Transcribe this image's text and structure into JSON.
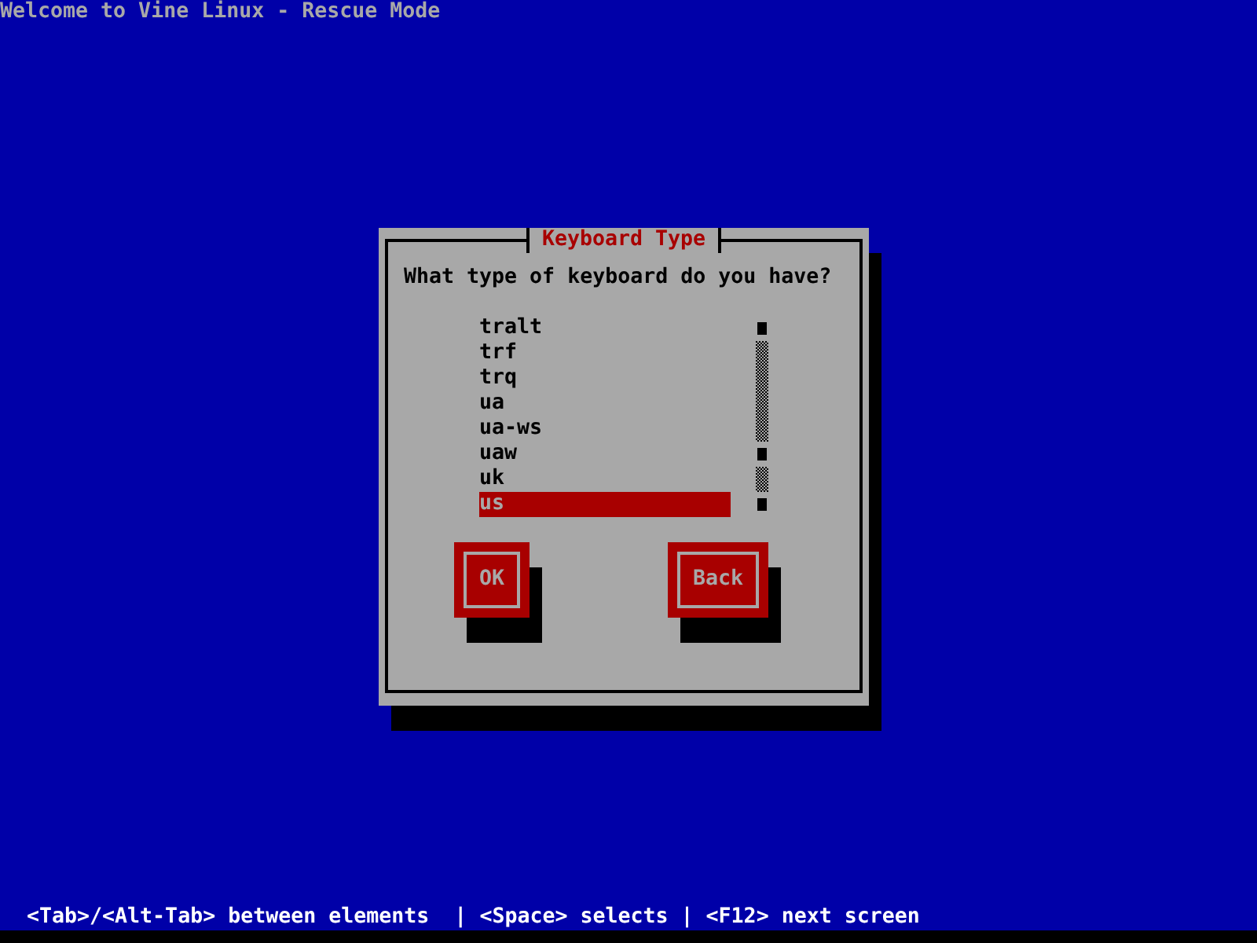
{
  "screen": {
    "title": "Welcome to Vine Linux - Rescue Mode"
  },
  "dialog": {
    "title": "Keyboard Type",
    "prompt": "What type of keyboard do you have?",
    "items": [
      {
        "label": "tralt",
        "selected": false
      },
      {
        "label": "trf",
        "selected": false
      },
      {
        "label": "trq",
        "selected": false
      },
      {
        "label": "ua",
        "selected": false
      },
      {
        "label": "ua-ws",
        "selected": false
      },
      {
        "label": "uaw",
        "selected": false
      },
      {
        "label": "uk",
        "selected": false
      },
      {
        "label": "us",
        "selected": true
      }
    ],
    "buttons": [
      {
        "label": "OK"
      },
      {
        "label": "Back"
      }
    ]
  },
  "status_bar": "<Tab>/<Alt-Tab> between elements  | <Space> selects | <F12> next screen"
}
